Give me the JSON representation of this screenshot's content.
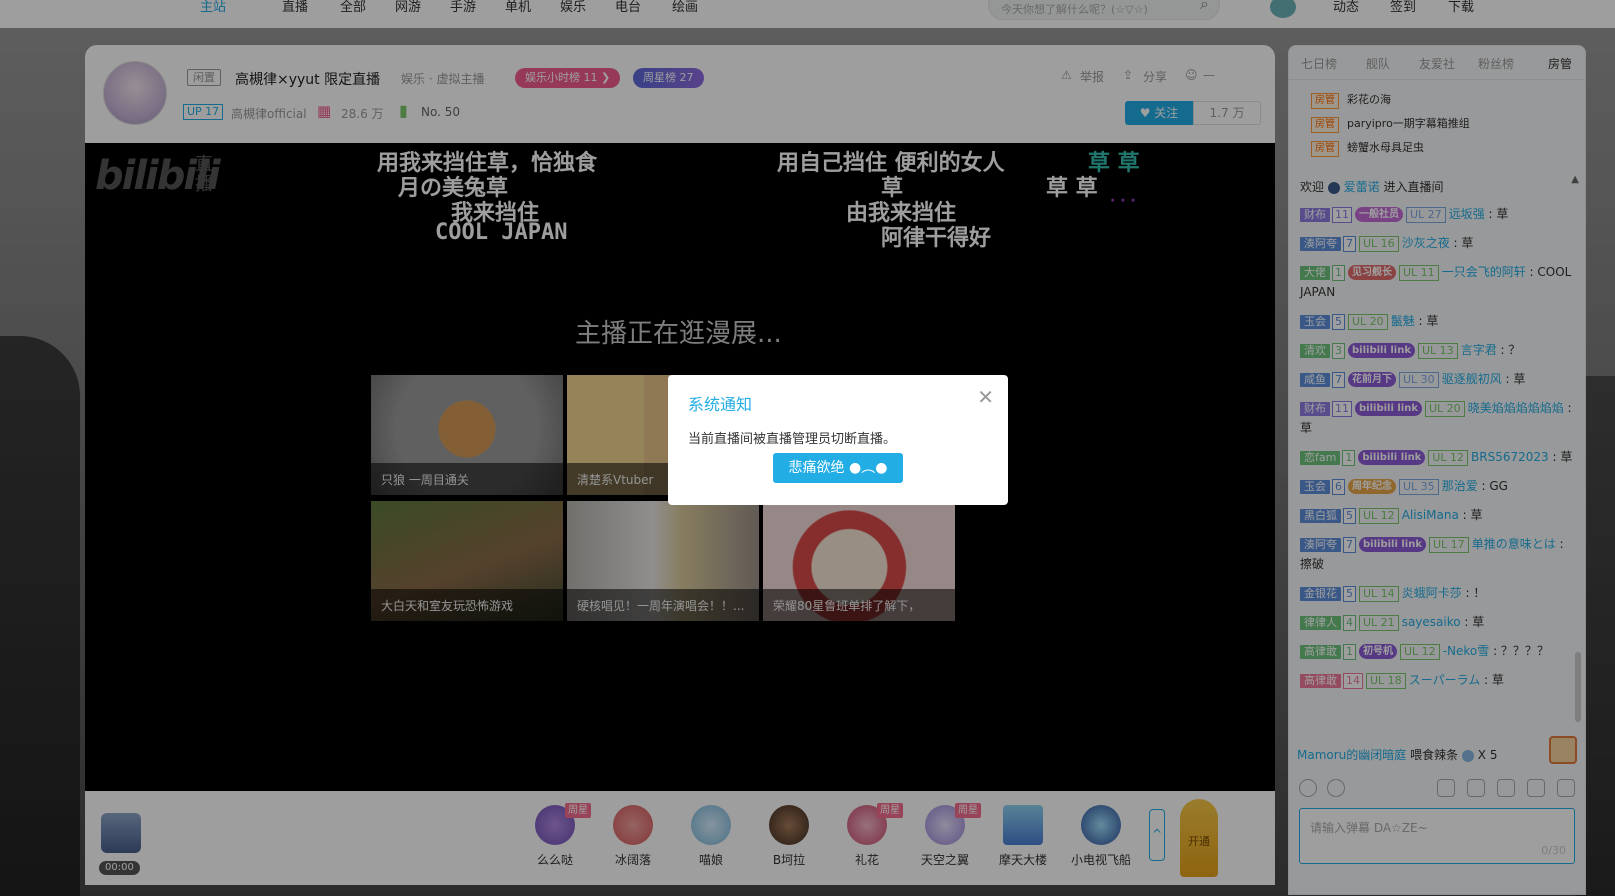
{
  "nav": {
    "items": [
      "主站",
      "直播",
      "全部",
      "网游",
      "手游",
      "单机",
      "娱乐",
      "电台",
      "绘画"
    ],
    "search_placeholder": "今天你想了解什么呢？(☆▽☆)",
    "right": [
      "动态",
      "签到",
      "下载"
    ]
  },
  "header": {
    "status_tag": "闲置",
    "title": "高槻律×yyut 限定直播",
    "area": "娱乐 · 虚拟主播",
    "rank_hour": "娱乐小时榜 11 ❯",
    "rank_week": "周星榜 27",
    "up_badge": "UP 17",
    "streamer": "高槻律official",
    "gifts": "28.6 万",
    "rank_no": "No. 50",
    "report": "举报",
    "share": "分享",
    "more": "—",
    "follow": "♥ 关注",
    "followers": "1.7 万"
  },
  "player": {
    "logo": "bilibili",
    "logo_sub": "直播",
    "danmaku": [
      "用我来挡住草，恰独食",
      "月の美兔草",
      "我来挡住",
      "COOL JAPAN",
      "用自己挡住 便利的女人",
      "草 草",
      "草",
      "草 草",
      "由我来挡住",
      "· · ·",
      "阿律干得好"
    ],
    "status": "主播正在逛漫展...",
    "cards": [
      "只狼 一周目通关",
      "清楚系Vtuber",
      "大白天和室友玩恐怖游戏",
      "硬核唱见！一周年演唱会！！...",
      "荣耀80星鲁班单排了解下，"
    ]
  },
  "gifts": {
    "items": [
      "么么哒",
      "冰阔落",
      "喵娘",
      "B坷拉",
      "礼花",
      "天空之翼",
      "摩天大楼",
      "小电视飞船"
    ],
    "tag": "周星",
    "time": "00:00",
    "start_label": "开通"
  },
  "modal": {
    "title": "系统通知",
    "message": "当前直播间被直播管理员切断直播。",
    "button": "悲痛欲绝 ●︵●"
  },
  "sidebar": {
    "tabs": [
      "七日榜",
      "舰队",
      "友爱社",
      "粉丝榜",
      "房管"
    ],
    "admin_badge": "房管",
    "admins": [
      "彩花の海",
      "paryipro一期字幕箱推组",
      "螃蟹水母具足虫"
    ],
    "welcome_prefix": "欢迎",
    "welcome_name": "爱蕾诺",
    "welcome_suffix": "进入直播间",
    "messages": [
      {
        "medal": "财布",
        "lv": "11",
        "mcolor": "#8e7be3",
        "img": "一般社员",
        "imgc": "#c46bd6",
        "ul": "UL 27",
        "ulc": "#7daae3",
        "user": "远坂强",
        "text": "草"
      },
      {
        "medal": "湊阿夸",
        "lv": "7",
        "mcolor": "#5d8fdb",
        "img": "",
        "imgc": "",
        "ul": "UL 16",
        "ulc": "#7bc86b",
        "user": "沙灰之夜",
        "text": "草"
      },
      {
        "medal": "大佬",
        "lv": "1",
        "mcolor": "#6fc47f",
        "img": "见习舰长",
        "imgc": "#e06b6b",
        "ul": "UL 11",
        "ulc": "#7bc86b",
        "user": "一只会飞的阿轩",
        "text": "COOL JAPAN"
      },
      {
        "medal": "玉会",
        "lv": "5",
        "mcolor": "#5d8fdb",
        "img": "",
        "imgc": "",
        "ul": "UL 20",
        "ulc": "#7bc86b",
        "user": "鬣魅",
        "text": "草"
      },
      {
        "medal": "清欢",
        "lv": "3",
        "mcolor": "#6fc47f",
        "img": "bilibili link",
        "imgc": "#8b5bd6",
        "ul": "UL 13",
        "ulc": "#7bc86b",
        "user": "言字君",
        "text": "？"
      },
      {
        "medal": "咸鱼",
        "lv": "7",
        "mcolor": "#5d8fdb",
        "img": "花前月下",
        "imgc": "#8b5bd6",
        "ul": "UL 30",
        "ulc": "#7daae3",
        "user": "驱逐舰初风",
        "text": "草"
      },
      {
        "medal": "财布",
        "lv": "11",
        "mcolor": "#8e7be3",
        "img": "bilibili link",
        "imgc": "#8b5bd6",
        "ul": "UL 20",
        "ulc": "#7bc86b",
        "user": "晓美焰焰焰焰焰焰",
        "text": "草"
      },
      {
        "medal": "恋fam",
        "lv": "1",
        "mcolor": "#6fc47f",
        "img": "bilibili link",
        "imgc": "#8b5bd6",
        "ul": "UL 12",
        "ulc": "#7bc86b",
        "user": "BRS5672023",
        "text": "草"
      },
      {
        "medal": "玉会",
        "lv": "6",
        "mcolor": "#5d8fdb",
        "img": "周年纪念",
        "imgc": "#e8a94b",
        "ul": "UL 35",
        "ulc": "#7daae3",
        "user": "那治爱",
        "text": "GG"
      },
      {
        "medal": "黑白狐",
        "lv": "5",
        "mcolor": "#5d8fdb",
        "img": "",
        "imgc": "",
        "ul": "UL 12",
        "ulc": "#7bc86b",
        "user": "AlisiMana",
        "text": "草"
      },
      {
        "medal": "湊阿夸",
        "lv": "7",
        "mcolor": "#5d8fdb",
        "img": "bilibili link",
        "imgc": "#8b5bd6",
        "ul": "UL 17",
        "ulc": "#7bc86b",
        "user": "单推の意味とは",
        "text": "擦破"
      },
      {
        "medal": "金银花",
        "lv": "5",
        "mcolor": "#5d8fdb",
        "img": "",
        "imgc": "",
        "ul": "UL 14",
        "ulc": "#7bc86b",
        "user": "炎蛾阿卡莎",
        "text": "！"
      },
      {
        "medal": "律律人",
        "lv": "4",
        "mcolor": "#6fc47f",
        "img": "",
        "imgc": "",
        "ul": "UL 21",
        "ulc": "#7bc86b",
        "user": "sayesaiko",
        "text": "草"
      },
      {
        "medal": "高律敢",
        "lv": "1",
        "mcolor": "#6fc47f",
        "img": "初号机",
        "imgc": "#8b5bd6",
        "ul": "UL 12",
        "ulc": "#7bc86b",
        "user": "-Neko雪",
        "text": "？？？？"
      },
      {
        "medal": "高律敢",
        "lv": "14",
        "mcolor": "#f07a9a",
        "img": "",
        "imgc": "",
        "ul": "UL 18",
        "ulc": "#7bc86b",
        "user": "スーパーラム",
        "text": "草"
      }
    ],
    "gift_user": "Mamoru的幽闭暗庭",
    "gift_text": "喂食辣条",
    "gift_count": "X 5",
    "input_placeholder": "请输入弹幕 DA☆ZE~",
    "input_count": "0/30"
  }
}
